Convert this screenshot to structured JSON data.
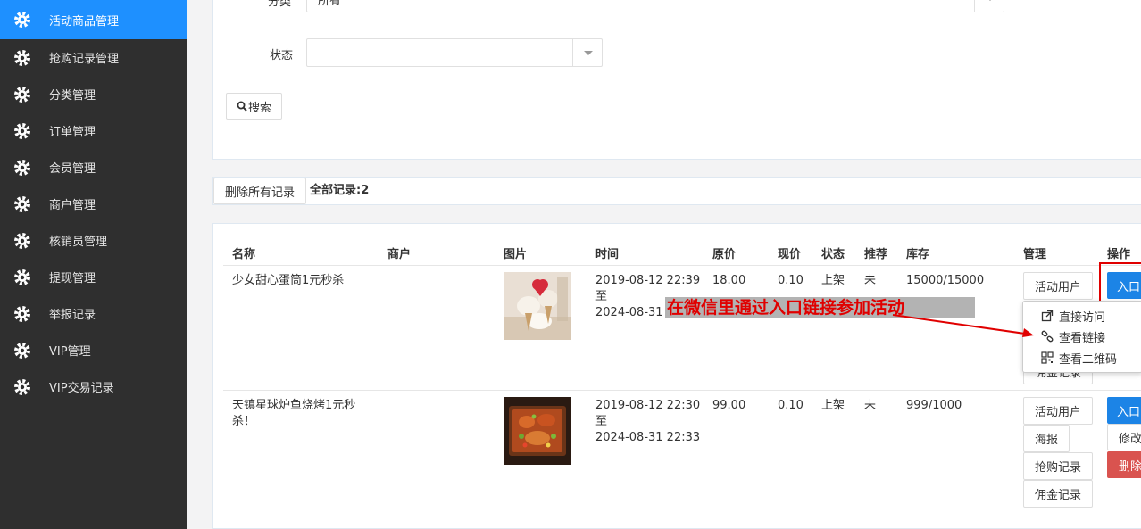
{
  "sidebar": {
    "items": [
      {
        "label": "活动商品管理",
        "active": true
      },
      {
        "label": "抢购记录管理"
      },
      {
        "label": "分类管理"
      },
      {
        "label": "订单管理"
      },
      {
        "label": "会员管理"
      },
      {
        "label": "商户管理"
      },
      {
        "label": "核销员管理"
      },
      {
        "label": "提现管理"
      },
      {
        "label": "举报记录"
      },
      {
        "label": "VIP管理"
      },
      {
        "label": "VIP交易记录"
      }
    ]
  },
  "filter": {
    "category_label": "分类",
    "category_value": "所有",
    "status_label": "状态",
    "status_value": "",
    "search_button": "搜索"
  },
  "toolbar": {
    "delete_all": "删除所有记录",
    "total": "全部记录:2"
  },
  "table": {
    "headers": [
      "名称",
      "商户",
      "图片",
      "时间",
      "原价",
      "现价",
      "状态",
      "推荐",
      "库存",
      "管理",
      "操作"
    ],
    "rows": [
      {
        "name": "少女甜心蛋筒1元秒杀",
        "merchant": "",
        "time_start": "2019-08-12 22:39",
        "time_sep": "至",
        "time_end": "2024-08-31",
        "original_price": "18.00",
        "current_price": "0.10",
        "status": "上架",
        "recommend": "未",
        "stock": "15000/15000",
        "manage_buttons": [
          "活动用户",
          "佣金记录"
        ],
        "op_buttons": [
          "入口"
        ]
      },
      {
        "name_line1": "天镇星球炉鱼烧烤1元秒",
        "name_line2": "杀！",
        "merchant": "",
        "time_start": "2019-08-12 22:30",
        "time_sep": "至",
        "time_end": "2024-08-31 22:33",
        "original_price": "99.00",
        "current_price": "0.10",
        "status": "上架",
        "recommend": "未",
        "stock": "999/1000",
        "manage_buttons": [
          "活动用户",
          "海报",
          "抢购记录",
          "佣金记录"
        ],
        "op_buttons": [
          "入口",
          "修改",
          "删除"
        ]
      }
    ]
  },
  "dropdown": {
    "items": [
      "直接访问",
      "查看链接",
      "查看二维码"
    ]
  },
  "annotation": {
    "text": "在微信里通过入口链接参加活动"
  },
  "colors": {
    "sidebar_bg": "#2f2f2f",
    "active": "#1e90ff",
    "primary": "#1c84e6",
    "danger": "#d9534f",
    "annotation_text": "#e00000",
    "highlight_box": "#e00000"
  }
}
